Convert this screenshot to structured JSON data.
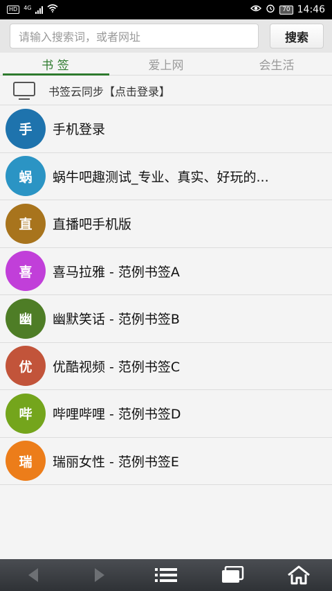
{
  "status_bar": {
    "hd": "HD",
    "network": "4G",
    "battery": "70",
    "time": "14:46"
  },
  "search": {
    "placeholder": "请输入搜索词，或者网址",
    "button_label": "搜索"
  },
  "tabs": [
    {
      "label": "书 签",
      "active": true
    },
    {
      "label": "爱上网",
      "active": false
    },
    {
      "label": "会生活",
      "active": false
    }
  ],
  "sync": {
    "label": "书签云同步【点击登录】",
    "icon": "monitor-icon"
  },
  "bookmarks": [
    {
      "avatar": "手",
      "title": "手机登录",
      "color": "#1e73ad"
    },
    {
      "avatar": "蜗",
      "title": "蜗牛吧趣测试_专业、真实、好玩的...",
      "color": "#2b94c4"
    },
    {
      "avatar": "直",
      "title": "直播吧手机版",
      "color": "#a8741d"
    },
    {
      "avatar": "喜",
      "title": "喜马拉雅 - 范例书签A",
      "color": "#c13fd9"
    },
    {
      "avatar": "幽",
      "title": "幽默笑话 - 范例书签B",
      "color": "#4e7d26"
    },
    {
      "avatar": "优",
      "title": "优酷视频 - 范例书签C",
      "color": "#c2543a"
    },
    {
      "avatar": "哔",
      "title": "哔哩哔哩 - 范例书签D",
      "color": "#74a51c"
    },
    {
      "avatar": "瑞",
      "title": "瑞丽女性 - 范例书签E",
      "color": "#ec7d1a"
    }
  ],
  "bottom_nav": [
    {
      "icon": "back-arrow-icon",
      "enabled": false
    },
    {
      "icon": "forward-arrow-icon",
      "enabled": false
    },
    {
      "icon": "menu-icon",
      "enabled": true
    },
    {
      "icon": "windows-icon",
      "enabled": true
    },
    {
      "icon": "home-icon",
      "enabled": true
    }
  ]
}
